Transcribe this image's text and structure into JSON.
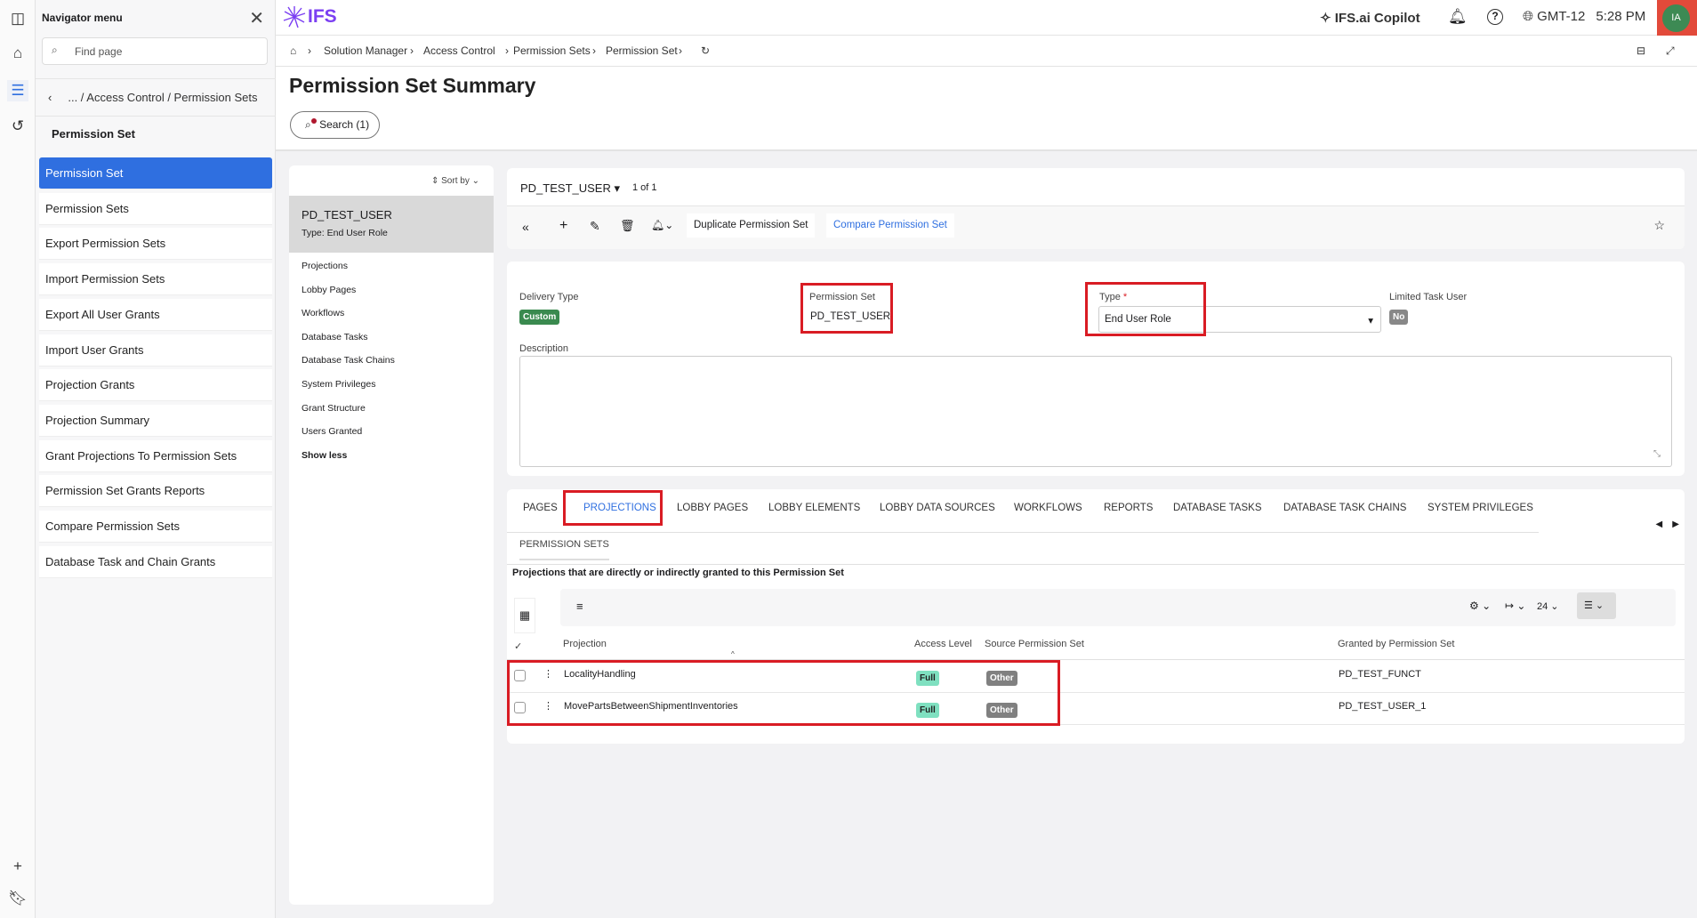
{
  "nav": {
    "title": "Navigator menu",
    "find_placeholder": "Find page",
    "back_path": "... / Access Control / Permission Sets",
    "section": "Permission Set",
    "items": [
      "Permission Set",
      "Permission Sets",
      "Export Permission Sets",
      "Import Permission Sets",
      "Export All User Grants",
      "Import User Grants",
      "Projection Grants",
      "Projection Summary",
      "Grant Projections To Permission Sets",
      "Permission Set Grants Reports",
      "Compare Permission Sets",
      "Database Task and Chain Grants"
    ]
  },
  "header": {
    "logo": "IFS",
    "copilot": "IFS.ai Copilot",
    "timezone": "GMT-12",
    "time": "5:28 PM",
    "avatar": "IA"
  },
  "breadcrumb": [
    "Solution Manager",
    "Access Control",
    "Permission Sets",
    "Permission Set"
  ],
  "page": {
    "title": "Permission Set Summary",
    "search_label": "Search (1)"
  },
  "list": {
    "sort_label": "Sort by",
    "selected": {
      "name": "PD_TEST_USER",
      "type": "Type:  End User Role"
    },
    "links": [
      "Projections",
      "Lobby Pages",
      "Workflows",
      "Database Tasks",
      "Database Task Chains",
      "System Privileges",
      "Grant Structure",
      "Users Granted"
    ],
    "show_less": "Show less"
  },
  "record": {
    "name": "PD_TEST_USER",
    "counter": "1 of 1",
    "duplicate": "Duplicate Permission Set",
    "compare": "Compare Permission Set"
  },
  "form": {
    "delivery_type_label": "Delivery Type",
    "delivery_type": "Custom",
    "perm_set_label": "Permission Set",
    "perm_set": "PD_TEST_USER",
    "type_label": "Type",
    "required": "*",
    "type": "End User Role",
    "limited_label": "Limited Task User",
    "limited": "No",
    "description_label": "Description"
  },
  "tabs": [
    "PAGES",
    "PROJECTIONS",
    "LOBBY PAGES",
    "LOBBY ELEMENTS",
    "LOBBY DATA SOURCES",
    "WORKFLOWS",
    "REPORTS",
    "DATABASE TASKS",
    "DATABASE TASK CHAINS",
    "SYSTEM PRIVILEGES"
  ],
  "subtab": "PERMISSION SETS",
  "grid": {
    "caption": "Projections that are directly or indirectly granted to this Permission Set",
    "page_size": "24",
    "columns": [
      "Projection",
      "Access Level",
      "Source Permission Set",
      "Granted by Permission Set"
    ],
    "rows": [
      {
        "projection": "LocalityHandling",
        "access": "Full",
        "source": "Other",
        "granted": "PD_TEST_FUNCT"
      },
      {
        "projection": "MovePartsBetweenShipmentInventories",
        "access": "Full",
        "source": "Other",
        "granted": "PD_TEST_USER_1"
      }
    ]
  },
  "colors": {
    "accent": "#2f6fe0",
    "highlight": "#d91c24",
    "custom": "#3a8a4f",
    "full": "#7fe0c0",
    "other": "#808080"
  }
}
